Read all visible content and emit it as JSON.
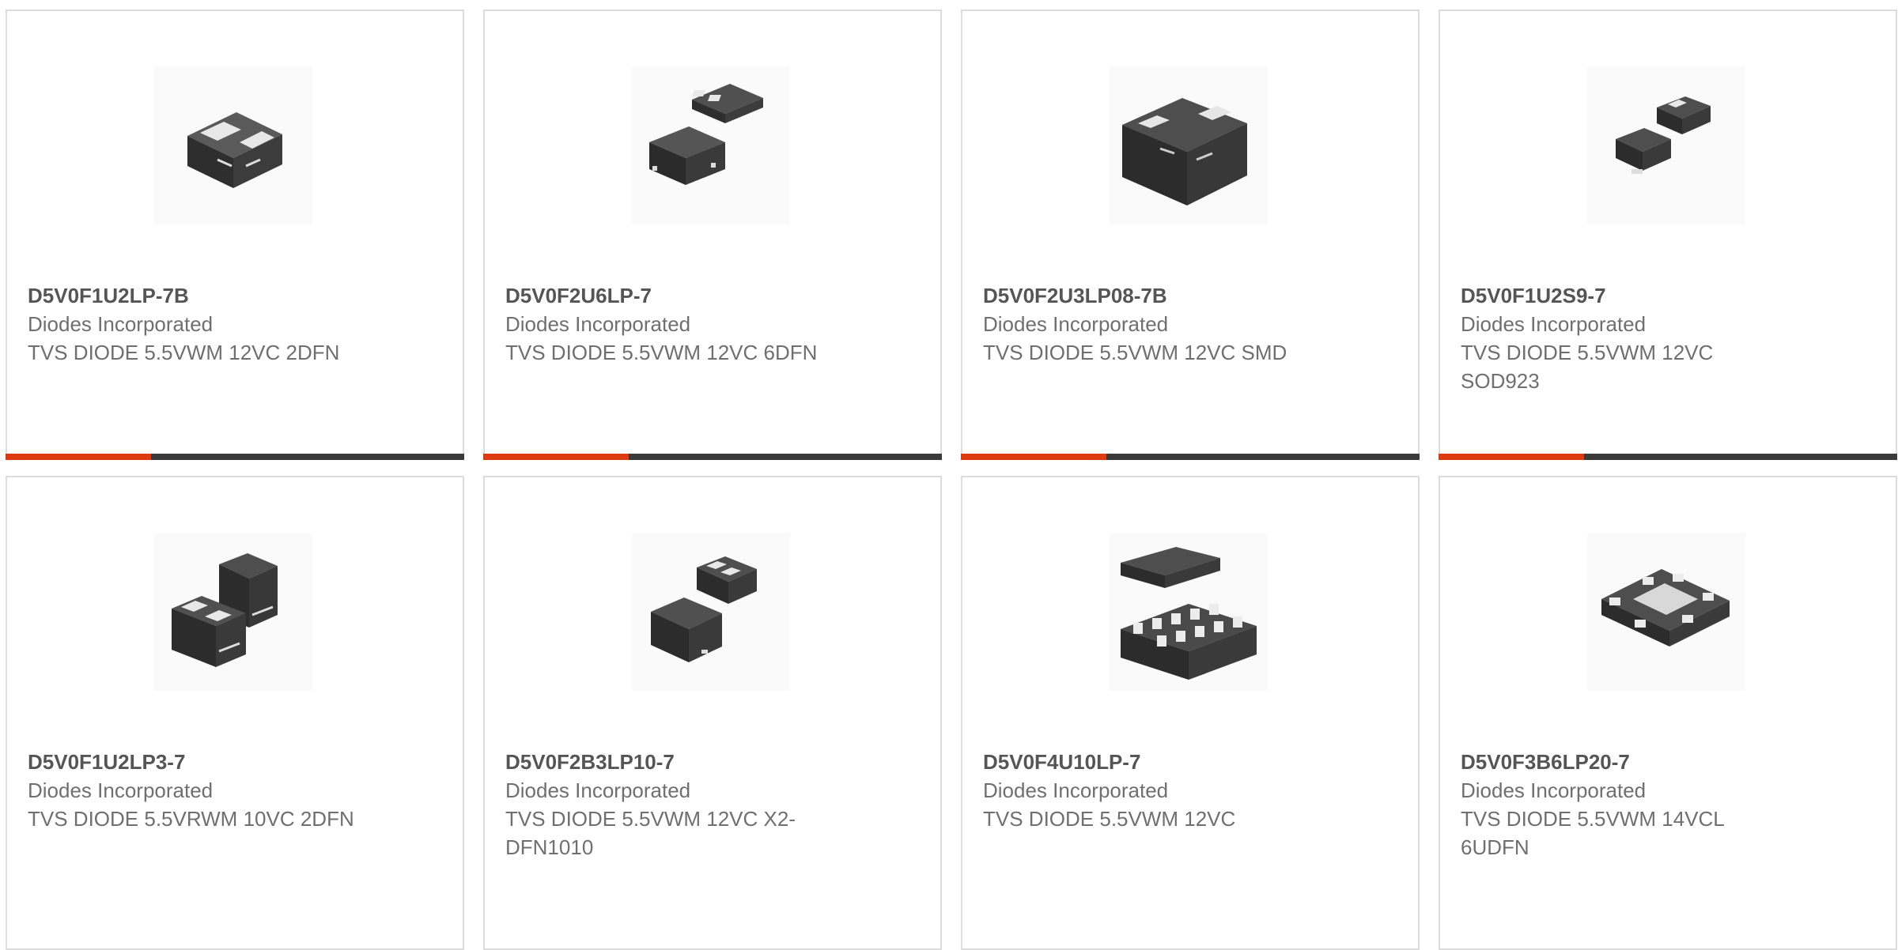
{
  "colors": {
    "accent": "#dd3a12",
    "bar": "#3a3a3a",
    "border": "#dcdcdc",
    "text": "#6f6f6f"
  },
  "products": [
    {
      "part": "D5V0F1U2LP-7B",
      "maker": "Diodes Incorporated",
      "desc": "TVS DIODE 5.5VWM 12VC 2DFN",
      "image": "2dfn-package-image"
    },
    {
      "part": "D5V0F2U6LP-7",
      "maker": "Diodes Incorporated",
      "desc": "TVS DIODE 5.5VWM 12VC 6DFN",
      "image": "6dfn-package-image"
    },
    {
      "part": "D5V0F2U3LP08-7B",
      "maker": "Diodes Incorporated",
      "desc": "TVS DIODE 5.5VWM 12VC SMD",
      "image": "smd-package-image"
    },
    {
      "part": "D5V0F1U2S9-7",
      "maker": "Diodes Incorporated",
      "desc": "TVS DIODE 5.5VWM 12VC SOD923",
      "image": "sod923-package-image"
    },
    {
      "part": "D5V0F1U2LP3-7",
      "maker": "Diodes Incorporated",
      "desc": "TVS DIODE 5.5VRWM 10VC 2DFN",
      "image": "2dfn-package-image"
    },
    {
      "part": "D5V0F2B3LP10-7",
      "maker": "Diodes Incorporated",
      "desc": "TVS DIODE 5.5VWM 12VC X2-DFN1010",
      "image": "x2dfn1010-package-image"
    },
    {
      "part": "D5V0F4U10LP-7",
      "maker": "Diodes Incorporated",
      "desc": "TVS DIODE 5.5VWM 12VC",
      "image": "10-pin-package-image"
    },
    {
      "part": "D5V0F3B6LP20-7",
      "maker": "Diodes Incorporated",
      "desc": "TVS DIODE 5.5VWM 14VCL 6UDFN",
      "image": "6udfn-package-image"
    }
  ]
}
